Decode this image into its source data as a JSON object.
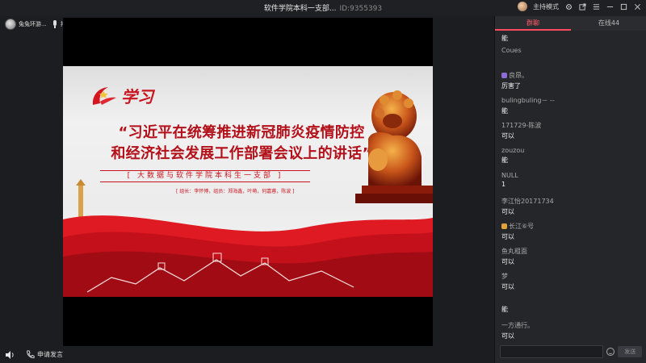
{
  "window": {
    "title": "软件学院本科一支部...",
    "room_id": "ID:9355393",
    "host_mode_label": "主持模式"
  },
  "userbar": {
    "user_name": "兔兔环游...",
    "mic_label": "排麦"
  },
  "slide": {
    "logo_text": "学习",
    "title_line1": "“习近平在统筹推进新冠肺炎疫情防控",
    "title_line2": "和经济社会发展工作部署会议上的讲话”",
    "subtitle": "[ 大数据与软件学院本科生一支部 ]",
    "members": "[ 组长：李怀博，组员：郑海鑫，叶萌，何嘉蓉，陈波 ]"
  },
  "bottombar": {
    "apply_label": "申请发言"
  },
  "chat": {
    "tabs": [
      {
        "label": "群聊",
        "active": true
      },
      {
        "label": "在线44",
        "active": false
      }
    ],
    "messages": [
      {
        "name": "",
        "text": "能"
      },
      {
        "name": "Coues",
        "text": ""
      },
      {
        "name": "良昂。",
        "text": "厉害了",
        "badge": "#8e6bd6"
      },
      {
        "name": "bulingbuling－ --",
        "text": "能"
      },
      {
        "name": "171729-陈波",
        "text": "可以"
      },
      {
        "name": "zouzou",
        "text": "能"
      },
      {
        "name": "NULL",
        "text": "1"
      },
      {
        "name": "李江怡20171734",
        "text": "可以"
      },
      {
        "name": "长江⑥号",
        "text": "可以",
        "badge": "#e0a33a"
      },
      {
        "name": "鱼丸粗面",
        "text": "可以"
      },
      {
        "name": "梦",
        "text": "可以"
      },
      {
        "name": "",
        "text": "能"
      },
      {
        "name": "一方通行。",
        "text": "可以"
      }
    ],
    "input_placeholder": "",
    "send_label": "发送"
  },
  "colors": {
    "accent": "#ff4d5e",
    "slide_red": "#c8141e"
  }
}
